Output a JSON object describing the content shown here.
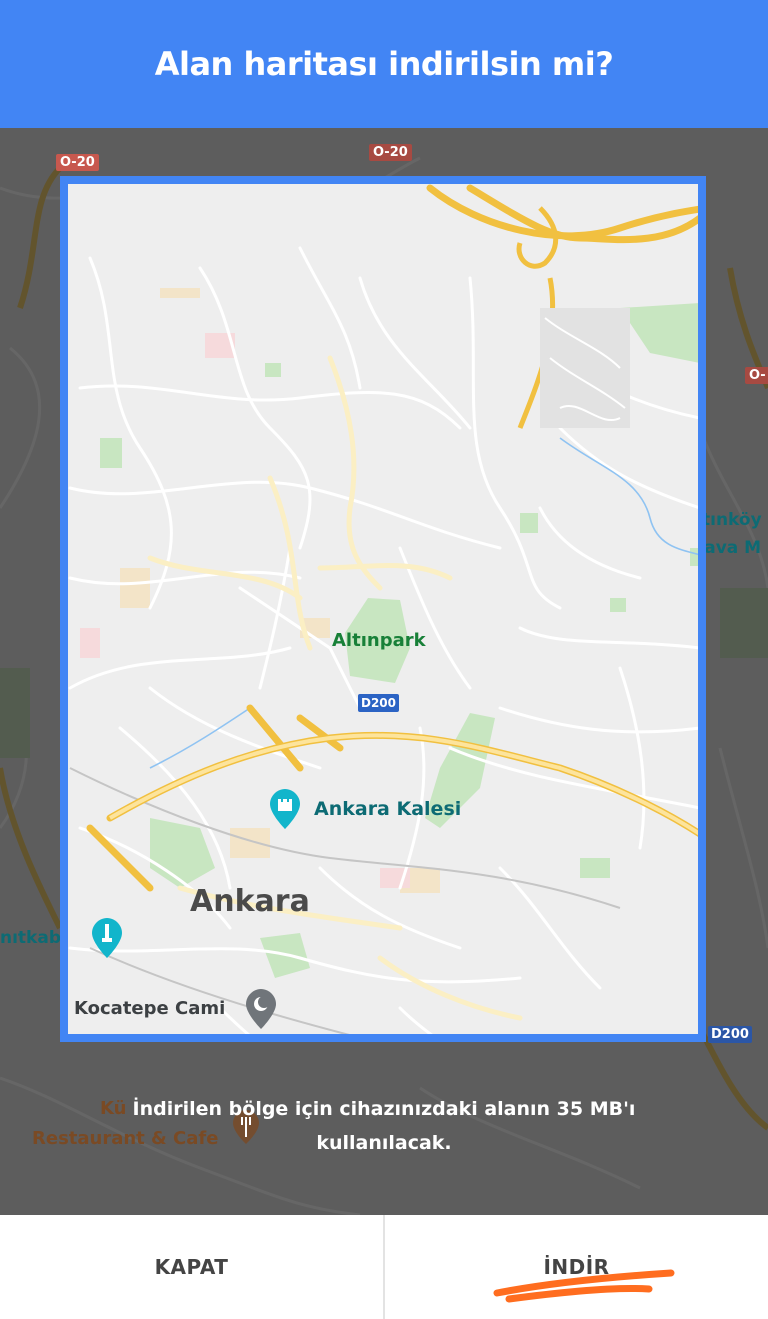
{
  "dialog": {
    "title": "Alan haritası indirilsin mi?",
    "notice": "İndirilen bölge için cihazınızdaki alanın 35 MB'ı kullanılacak.",
    "close_label": "KAPAT",
    "download_label": "İNDİR"
  },
  "map": {
    "road_labels": [
      "O-20",
      "O-20",
      "D200",
      "D200",
      "O-"
    ],
    "place_labels": {
      "altinpark": "Altınpark",
      "ankara_kalesi": "Ankara Kalesi",
      "ankara": "Ankara",
      "kocatepe": "Kocatepe Cami",
      "anitkabir_fragment": "nıtkabir",
      "altinkoy_line1": "Altınköy",
      "altinkoy_line2": "Hava M",
      "restaurant_line1": "Kü",
      "restaurant_line2": "Restaurant & Cafe"
    }
  },
  "colors": {
    "header_blue": "#4285f4",
    "park_green": "#188038",
    "poi_teal": "#12b5cb",
    "highway_yellow": "#f8d36a",
    "annotation_orange": "#ff6d1f"
  }
}
